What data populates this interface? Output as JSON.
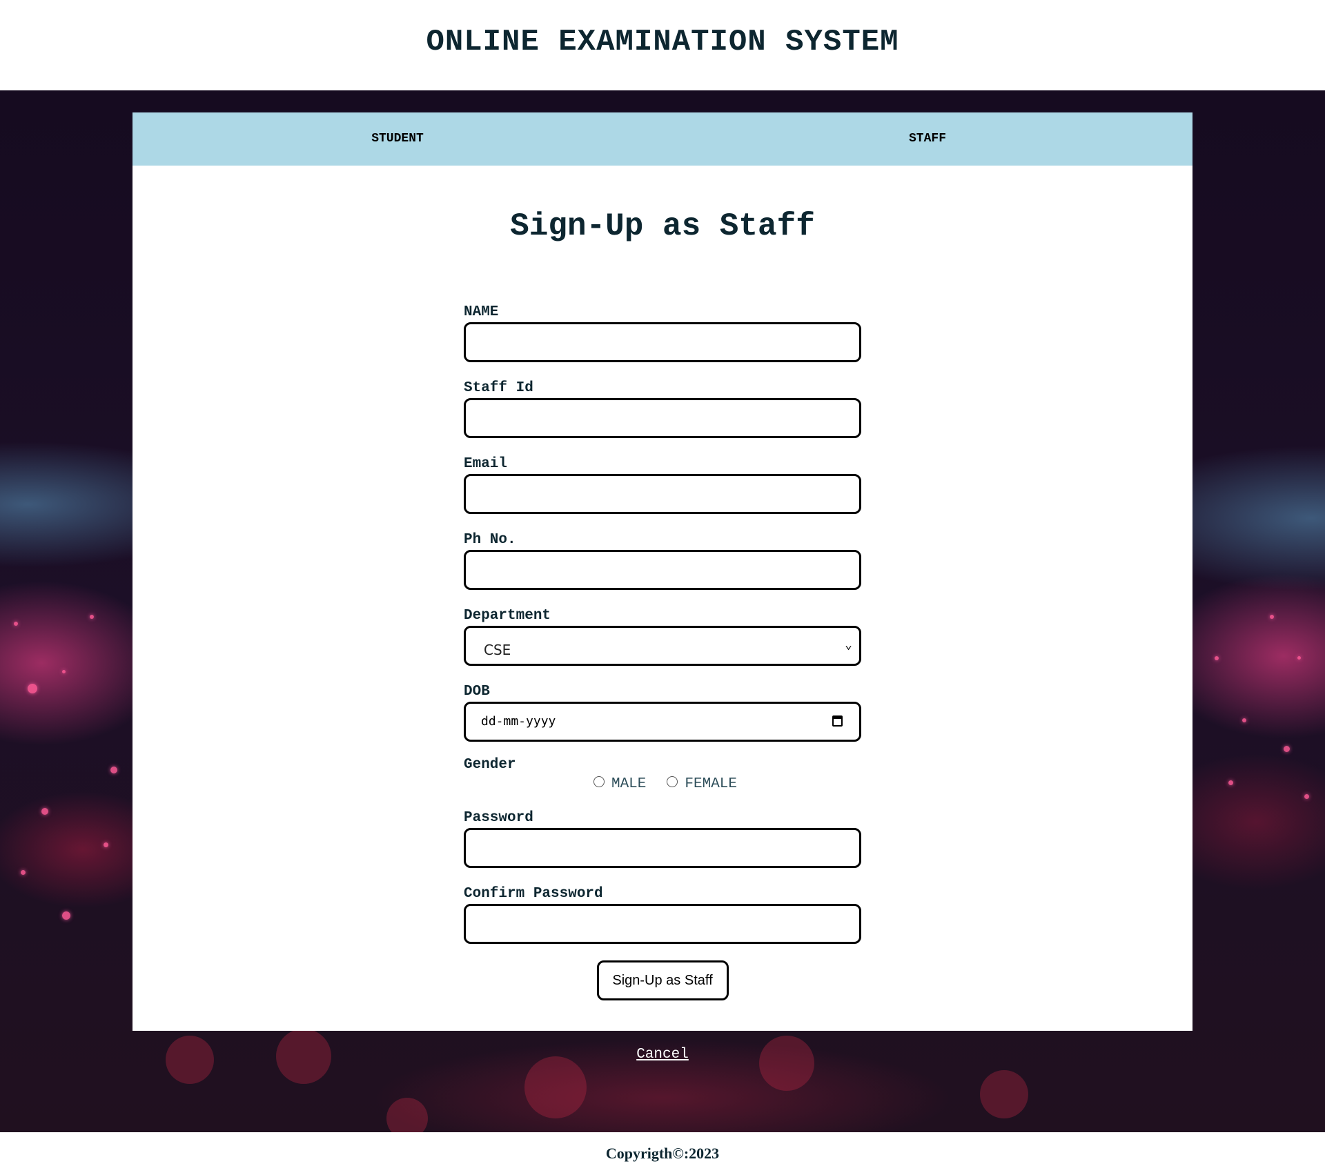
{
  "header": {
    "title": "ONLINE EXAMINATION SYSTEM"
  },
  "nav": {
    "items": [
      {
        "label": "STUDENT"
      },
      {
        "label": "STAFF"
      }
    ]
  },
  "form": {
    "title": "Sign-Up as Staff",
    "fields": {
      "name": {
        "label": "NAME",
        "value": ""
      },
      "staff_id": {
        "label": "Staff Id",
        "value": ""
      },
      "email": {
        "label": "Email",
        "value": ""
      },
      "phone": {
        "label": "Ph No.",
        "value": ""
      },
      "department": {
        "label": "Department",
        "selected": "CSE"
      },
      "dob": {
        "label": "DOB",
        "placeholder": "dd-mm-yyyy"
      },
      "gender": {
        "label": "Gender",
        "options": [
          "MALE",
          "FEMALE"
        ]
      },
      "password": {
        "label": "Password",
        "value": ""
      },
      "confirm_password": {
        "label": "Confirm Password",
        "value": ""
      }
    },
    "submit_label": "Sign-Up as Staff"
  },
  "cancel_label": "Cancel",
  "footer": {
    "text": "Copyrigth©:2023"
  },
  "colors": {
    "nav_bg": "#add8e6",
    "title_text": "#0d2630",
    "page_bg": "#1c0f27"
  },
  "icons": {
    "calendar": "calendar-icon",
    "chevron": "chevron-down-icon"
  }
}
